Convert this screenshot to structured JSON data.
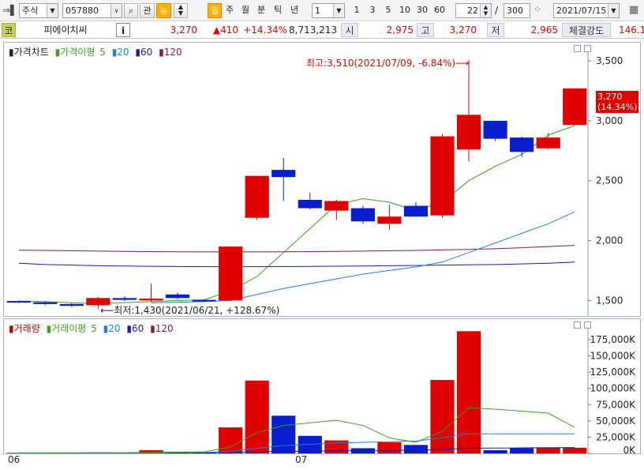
{
  "toolbar": {
    "market_select": "주식",
    "code_input": "057880",
    "btn_watch": "관",
    "btn_news": "뉴",
    "period_buttons": [
      "일",
      "주",
      "월",
      "분",
      "틱",
      "년"
    ],
    "interval_value": "1",
    "interval_buttons": [
      "1",
      "3",
      "5",
      "10",
      "30",
      "60"
    ],
    "count_value": "22",
    "count_separator": "/",
    "count_total": "300",
    "date_value": "2021/07/15"
  },
  "quote": {
    "market_icon": "코",
    "name": "피에이치씨",
    "info_btn": "i",
    "price": "3,270",
    "change": "▲410",
    "change_pct": "+14.34%",
    "volume": "8,713,213",
    "open_label": "시",
    "open": "2,975",
    "high_label": "고",
    "high": "3,270",
    "low_label": "저",
    "low": "2,965",
    "strength_label": "체결강도",
    "strength": "146.1"
  },
  "price_panel": {
    "legend_title": "가격차트",
    "legend_ma": "가격이평",
    "ma_periods": [
      "5",
      "20",
      "60",
      "120"
    ],
    "ma_colors": [
      "#3f9d1e",
      "#1f7fd0",
      "#1c1c9a",
      "#7b1a4f"
    ],
    "max_annotation": "최고:3,510(2021/07/09, -6.84%)",
    "min_annotation": "최저:1,430(2021/06/21, +128.67%)",
    "current_tag_price": "3,270",
    "current_tag_pct": "(14.34%)"
  },
  "volume_panel": {
    "legend_title": "거래량",
    "legend_ma": "거래이평",
    "ma_periods": [
      "5",
      "20",
      "60",
      "120"
    ]
  },
  "x_labels": [
    "06",
    "07"
  ],
  "colors": {
    "up": "#e00000",
    "down": "#0a1ed0"
  },
  "chart_data": [
    {
      "type": "candlestick",
      "title": "가격차트",
      "y_ticks": [
        1500,
        2000,
        2500,
        3000,
        3500
      ],
      "y_tick_labels": [
        "1,500",
        "2,000",
        "2,500",
        "3,000",
        "3,500"
      ],
      "ylim": [
        1410,
        3560
      ],
      "candles": [
        {
          "o": 1495,
          "h": 1500,
          "l": 1480,
          "c": 1485
        },
        {
          "o": 1485,
          "h": 1495,
          "l": 1460,
          "c": 1470
        },
        {
          "o": 1470,
          "h": 1480,
          "l": 1445,
          "c": 1455
        },
        {
          "o": 1460,
          "h": 1530,
          "l": 1430,
          "c": 1520
        },
        {
          "o": 1520,
          "h": 1535,
          "l": 1495,
          "c": 1505
        },
        {
          "o": 1500,
          "h": 1640,
          "l": 1490,
          "c": 1515
        },
        {
          "o": 1550,
          "h": 1565,
          "l": 1510,
          "c": 1520
        },
        {
          "o": 1505,
          "h": 1510,
          "l": 1495,
          "c": 1500
        },
        {
          "o": 1500,
          "h": 1950,
          "l": 1495,
          "c": 1950
        },
        {
          "o": 2190,
          "h": 2540,
          "l": 2170,
          "c": 2540
        },
        {
          "o": 2590,
          "h": 2690,
          "l": 2330,
          "c": 2530
        },
        {
          "o": 2340,
          "h": 2400,
          "l": 2260,
          "c": 2270
        },
        {
          "o": 2250,
          "h": 2340,
          "l": 2170,
          "c": 2330
        },
        {
          "o": 2270,
          "h": 2290,
          "l": 2140,
          "c": 2160
        },
        {
          "o": 2140,
          "h": 2300,
          "l": 2090,
          "c": 2200
        },
        {
          "o": 2290,
          "h": 2320,
          "l": 2200,
          "c": 2200
        },
        {
          "o": 2210,
          "h": 2890,
          "l": 2190,
          "c": 2870
        },
        {
          "o": 2760,
          "h": 3510,
          "l": 2660,
          "c": 3050
        },
        {
          "o": 3000,
          "h": 3000,
          "l": 2830,
          "c": 2850
        },
        {
          "o": 2860,
          "h": 2870,
          "l": 2700,
          "c": 2740
        },
        {
          "o": 2770,
          "h": 2900,
          "l": 2760,
          "c": 2860
        },
        {
          "o": 2965,
          "h": 3270,
          "l": 2965,
          "c": 3270
        }
      ],
      "ma5": [
        1495,
        1490,
        1480,
        1475,
        1482,
        1490,
        1500,
        1505,
        1580,
        1700,
        1900,
        2100,
        2300,
        2350,
        2320,
        2250,
        2320,
        2500,
        2620,
        2720,
        2880,
        2960
      ],
      "ma20": [
        null,
        null,
        null,
        null,
        null,
        1480,
        1485,
        1490,
        1500,
        1550,
        1600,
        1640,
        1680,
        1720,
        1750,
        1780,
        1820,
        1900,
        1980,
        2060,
        2140,
        2240
      ],
      "ma60": [
        1810,
        1800,
        1795,
        1790,
        1788,
        1785,
        1783,
        1782,
        1782,
        1782,
        1783,
        1784,
        1786,
        1788,
        1790,
        1792,
        1795,
        1798,
        1800,
        1805,
        1810,
        1820
      ],
      "ma120": [
        1920,
        1918,
        1915,
        1912,
        1910,
        1908,
        1906,
        1905,
        1905,
        1905,
        1906,
        1908,
        1910,
        1912,
        1915,
        1918,
        1922,
        1926,
        1932,
        1940,
        1950,
        1960
      ]
    },
    {
      "type": "bar",
      "title": "거래량",
      "y_ticks": [
        0,
        25000,
        50000,
        75000,
        100000,
        125000,
        150000,
        175000
      ],
      "y_tick_labels": [
        "0K",
        "25,000K",
        "50,000K",
        "75,000K",
        "100,000K",
        "125,000K",
        "150,000K",
        "175,000K"
      ],
      "ylim": [
        0,
        192000
      ],
      "values": [
        800,
        700,
        900,
        1500,
        1200,
        5000,
        2000,
        1500,
        40000,
        112000,
        58000,
        27000,
        20000,
        8000,
        17000,
        13000,
        113000,
        188000,
        5000,
        8000,
        9000,
        8700
      ],
      "ma5": [
        800,
        800,
        850,
        900,
        1000,
        1800,
        2100,
        2300,
        10000,
        32000,
        43000,
        47000,
        51000,
        43000,
        24000,
        17000,
        34000,
        70000,
        68000,
        65000,
        62000,
        40000
      ],
      "ma20": [
        500,
        600,
        700,
        800,
        900,
        1000,
        1300,
        1500,
        3000,
        8000,
        12000,
        14000,
        16000,
        17000,
        18000,
        19000,
        24000,
        30000,
        30000,
        30000,
        30000,
        30000
      ],
      "ma60": [
        600,
        600,
        600,
        600,
        650,
        700,
        750,
        800,
        1200,
        2500,
        3000,
        3500,
        4000,
        4300,
        4600,
        5000,
        6000,
        8000,
        8200,
        8500,
        8700,
        9000
      ]
    }
  ]
}
